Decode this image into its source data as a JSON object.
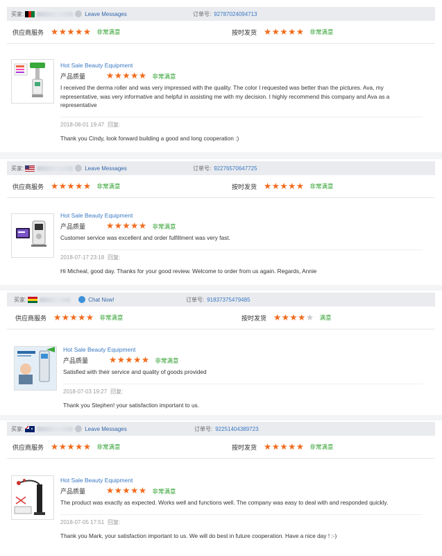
{
  "labels": {
    "buyer": "买家:",
    "order": "订单号:",
    "supplier_service": "供应商服务",
    "on_time": "按时发货",
    "product_quality": "产品质量",
    "reply": "回复:",
    "very_satisfied": "非常满意",
    "satisfied": "满意"
  },
  "colors": {
    "star": "#f26a1b",
    "satisfied_text": "#2a9d2a",
    "link": "#3a78c3",
    "bar": "#e9ebef"
  },
  "reviews": [
    {
      "contact": "Leave Messages",
      "order_no": "92787024094713",
      "supplier_stars": 5,
      "supplier_text": "非常满意",
      "ontime_stars": 5,
      "ontime_text": "非常满意",
      "product": "Hot Sale Beauty Equipment",
      "quality_stars": 5,
      "quality_text": "非常满意",
      "comment": "I received the derma roller and was very impressed with the quality. The color I requested was better than the pictures. Ava, my representative, was very informative and helpful in assisting me with my decision. I highly recommend this company and Ava as a representative",
      "date": "2018-08-01 19:47",
      "reply_text": "Thank you Cindy, look forward building a good and long cooperation :)"
    },
    {
      "contact": "Leave Messages",
      "order_no": "92276570647725",
      "supplier_stars": 5,
      "supplier_text": "非常满意",
      "ontime_stars": 5,
      "ontime_text": "非常满意",
      "product": "Hot Sale Beauty Equipment",
      "quality_stars": 5,
      "quality_text": "非常满意",
      "comment": "Customer service was excellent and order fulfillment was very fast.",
      "date": "2018-07-17 23:18",
      "reply_text": "Hi Micheal, good day. Thanks for your good review. Welcome to order from us again. Regards, Annie"
    },
    {
      "contact": "Chat Now!",
      "order_no": "91837375479485",
      "supplier_stars": 5,
      "supplier_text": "非常满意",
      "ontime_stars": 4,
      "ontime_text": "满意",
      "product": "Hot Sale Beauty Equipment",
      "quality_stars": 5,
      "quality_text": "非常满意",
      "comment": "Satisfied with their service and quality of goods provided",
      "date": "2018-07-03 19:27",
      "reply_text": "Thank you Stephen! your satisfaction important to us."
    },
    {
      "contact": "Leave Messages",
      "order_no": "92251404389723",
      "supplier_stars": 5,
      "supplier_text": "非常满意",
      "ontime_stars": 5,
      "ontime_text": "非常满意",
      "product": "Hot Sale Beauty Equipment",
      "quality_stars": 5,
      "quality_text": "非常满意",
      "comment": "The product was exactly as expected. Works well and functions well. The company was easy to deal with and responded quickly.",
      "date": "2018-07-05 17:51",
      "reply_text": "Thank you Mark, your satisfaction important to us. We will do best in future cooperation. Have a nice day ! :-)"
    }
  ]
}
